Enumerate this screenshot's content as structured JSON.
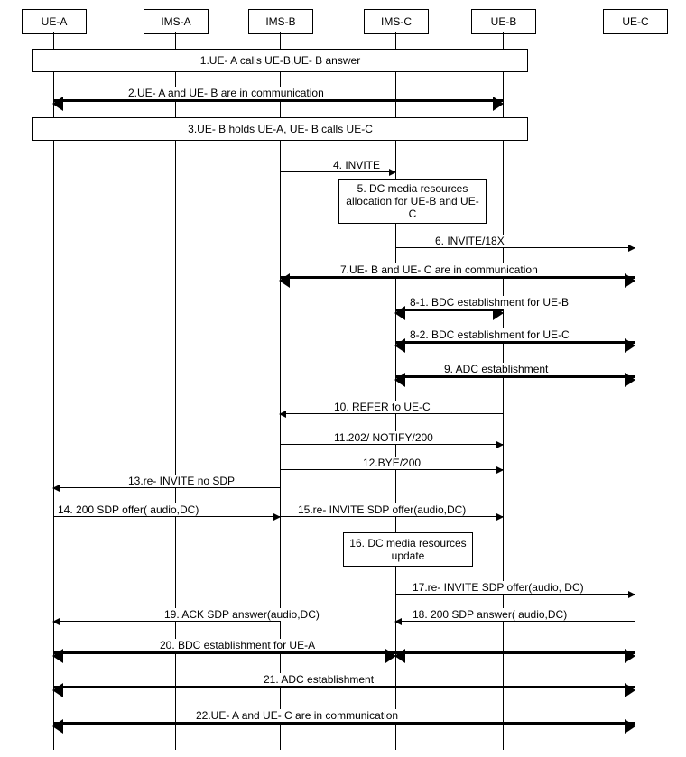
{
  "participants": {
    "ue_a": "UE-A",
    "ims_a": "IMS-A",
    "ims_b": "IMS-B",
    "ims_c": "IMS-C",
    "ue_b": "UE-B",
    "ue_c": "UE-C"
  },
  "steps": {
    "s1": "1.UE- A calls UE-B,UE- B answer",
    "s2": "2.UE- A and UE- B are in communication",
    "s3": "3.UE- B holds UE-A, UE- B calls UE-C",
    "s4": "4. INVITE",
    "s5": "5.   DC media resources allocation for UE-B and UE-C",
    "s6": "6. INVITE/18X",
    "s7": "7.UE- B and UE- C are in communication",
    "s8_1": "8-1.   BDC establishment for UE-B",
    "s8_2": "8-2.   BDC establishment for UE-C",
    "s9": "9. ADC establishment",
    "s10": "10.  REFER to UE-C",
    "s11": "11.202/ NOTIFY/200",
    "s12": "12.BYE/200",
    "s13": "13.re-  INVITE no SDP",
    "s14": "14. 200 SDP offer( audio,DC)",
    "s15": "15.re-  INVITE SDP offer(audio,DC)",
    "s16": "16.  DC media resources update",
    "s17": "17.re-  INVITE SDP offer(audio, DC)",
    "s18": "18. 200 SDP answer( audio,DC)",
    "s19": "19.  ACK SDP answer(audio,DC)",
    "s20": "20.   BDC establishment for UE-A",
    "s21": "21.  ADC establishment",
    "s22": "22.UE- A and UE- C are in communication"
  }
}
